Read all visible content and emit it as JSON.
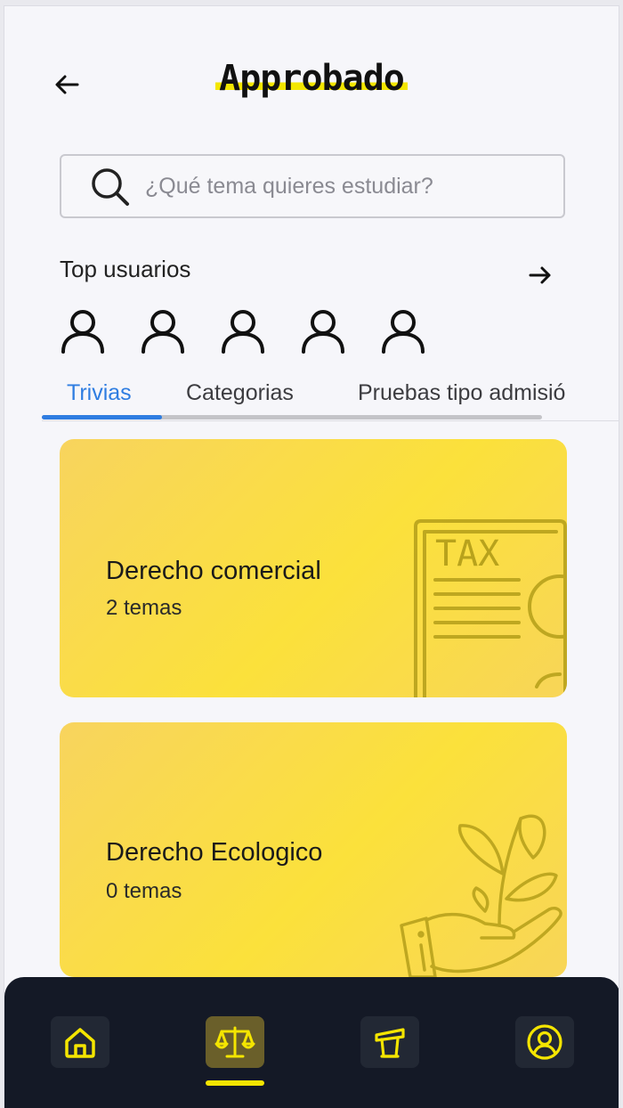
{
  "app": {
    "title": "Approbado"
  },
  "search": {
    "placeholder": "¿Qué tema quieres estudiar?"
  },
  "top_users": {
    "title": "Top usuarios",
    "count": 5
  },
  "tabs": [
    {
      "label": "Trivias",
      "active": true
    },
    {
      "label": "Categorias",
      "active": false
    },
    {
      "label": "Pruebas tipo admisió",
      "active": false
    }
  ],
  "cards": [
    {
      "title": "Derecho comercial",
      "subtitle": "2 temas",
      "illustration": "tax-document-icon",
      "illustration_text": "TAX"
    },
    {
      "title": "Derecho Ecologico",
      "subtitle": "0 temas",
      "illustration": "plant-in-hand-icon"
    }
  ],
  "bottom_nav": [
    {
      "icon": "home-icon",
      "active": false
    },
    {
      "icon": "scales-icon",
      "active": true
    },
    {
      "icon": "podium-icon",
      "active": false
    },
    {
      "icon": "user-circle-icon",
      "active": false
    }
  ],
  "colors": {
    "accent_blue": "#2f7de1",
    "card_yellow": "#fbe13b",
    "nav_background": "#141926",
    "nav_icon_yellow": "#f4e500"
  }
}
